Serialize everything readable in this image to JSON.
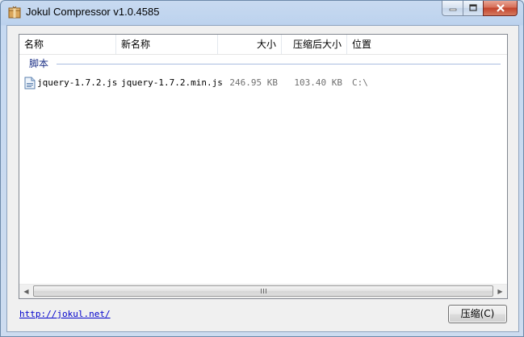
{
  "window": {
    "title": "Jokul Compressor v1.0.4585"
  },
  "icons": {
    "app": "package-icon",
    "minimize": "minimize-icon",
    "maximize": "maximize-icon",
    "close": "close-icon",
    "file": "js-file-icon"
  },
  "list": {
    "columns": [
      "名称",
      "新名称",
      "大小",
      "压缩后大小",
      "位置"
    ],
    "group": "脚本",
    "rows": [
      {
        "name": "jquery-1.7.2.js",
        "new_name": "jquery-1.7.2.min.js",
        "size": "246.95 KB",
        "compressed_size": "103.40 KB",
        "location": "C:\\"
      }
    ]
  },
  "scrollbar": {
    "left_arrow": "◀",
    "right_arrow": "▶"
  },
  "footer": {
    "link": "http://jokul.net/",
    "compress_button": "压缩(C)"
  },
  "colors": {
    "group_text": "#1e3287",
    "link": "#0000cc",
    "close_button": "#c2432b"
  }
}
